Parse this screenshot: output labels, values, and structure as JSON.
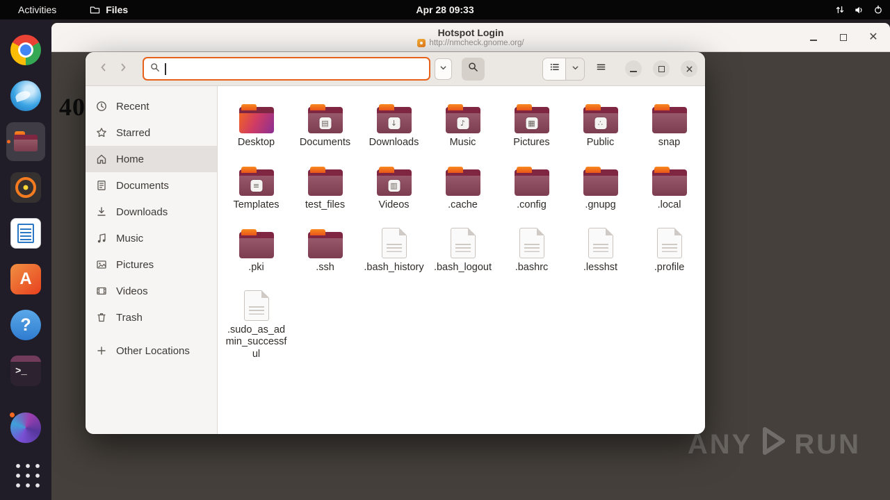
{
  "topbar": {
    "activities_label": "Activities",
    "focused_app": "Files",
    "clock": "Apr 28 09:33",
    "tray_icons": [
      "network-transfer-icon",
      "volume-icon",
      "power-icon"
    ]
  },
  "dock": {
    "items": [
      {
        "name": "chrome",
        "active": false
      },
      {
        "name": "thunderbird",
        "active": false
      },
      {
        "name": "files",
        "active": true
      },
      {
        "name": "rhythmbox",
        "active": false
      },
      {
        "name": "libreoffice-writer",
        "active": false
      },
      {
        "name": "app-center",
        "active": false
      },
      {
        "name": "help",
        "active": false
      },
      {
        "name": "terminal",
        "active": false
      },
      {
        "name": "user-avatar",
        "active": false,
        "notification": true,
        "push_bottom": true
      },
      {
        "name": "app-grid",
        "active": false
      }
    ]
  },
  "hotspot_window": {
    "title": "Hotspot Login",
    "url": "http://nmcheck.gnome.org/",
    "content_text": "40"
  },
  "watermark": {
    "left": "ANY",
    "right": "RUN"
  },
  "files_window": {
    "search": {
      "value": ""
    },
    "selected_sidebar_item": "Home",
    "sidebar": [
      {
        "label": "Recent",
        "icon": "clock-icon"
      },
      {
        "label": "Starred",
        "icon": "star-icon"
      },
      {
        "label": "Home",
        "icon": "home-icon"
      },
      {
        "label": "Documents",
        "icon": "document-icon"
      },
      {
        "label": "Downloads",
        "icon": "download-icon"
      },
      {
        "label": "Music",
        "icon": "music-icon"
      },
      {
        "label": "Pictures",
        "icon": "picture-icon"
      },
      {
        "label": "Videos",
        "icon": "video-icon"
      },
      {
        "label": "Trash",
        "icon": "trash-icon"
      },
      {
        "label": "Other Locations",
        "icon": "plus-icon"
      }
    ],
    "grid": [
      {
        "label": "Desktop",
        "kind": "folder",
        "emblem": "desktop"
      },
      {
        "label": "Documents",
        "kind": "folder",
        "emblem": "document"
      },
      {
        "label": "Downloads",
        "kind": "folder",
        "emblem": "download"
      },
      {
        "label": "Music",
        "kind": "folder",
        "emblem": "music"
      },
      {
        "label": "Pictures",
        "kind": "folder",
        "emblem": "picture"
      },
      {
        "label": "Public",
        "kind": "folder",
        "emblem": "share"
      },
      {
        "label": "snap",
        "kind": "folder"
      },
      {
        "label": "Templates",
        "kind": "folder",
        "emblem": "template"
      },
      {
        "label": "test_files",
        "kind": "folder"
      },
      {
        "label": "Videos",
        "kind": "folder",
        "emblem": "film"
      },
      {
        "label": ".cache",
        "kind": "folder"
      },
      {
        "label": ".config",
        "kind": "folder"
      },
      {
        "label": ".gnupg",
        "kind": "folder"
      },
      {
        "label": ".local",
        "kind": "folder"
      },
      {
        "label": ".pki",
        "kind": "folder"
      },
      {
        "label": ".ssh",
        "kind": "folder"
      },
      {
        "label": ".bash_history",
        "kind": "file"
      },
      {
        "label": ".bash_logout",
        "kind": "file"
      },
      {
        "label": ".bashrc",
        "kind": "file"
      },
      {
        "label": ".lesshst",
        "kind": "file"
      },
      {
        "label": ".profile",
        "kind": "file"
      },
      {
        "label": ".sudo_as_admin_successful",
        "kind": "file"
      }
    ]
  }
}
